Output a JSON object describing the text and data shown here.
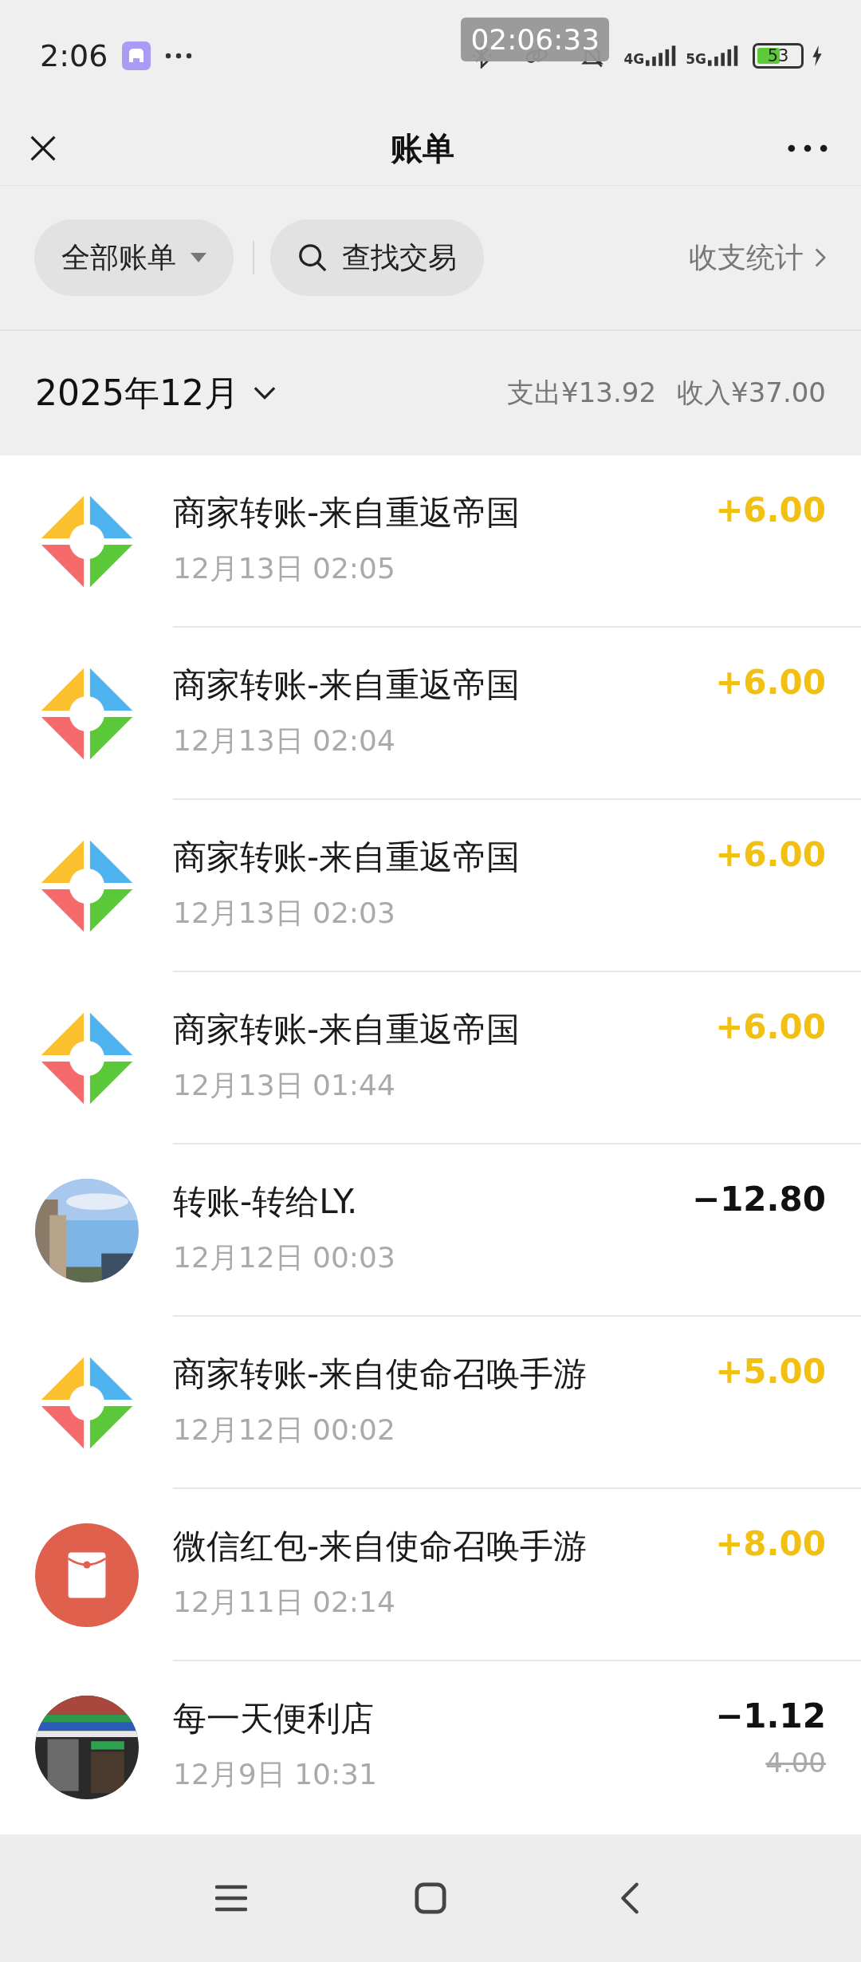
{
  "status_bar": {
    "time": "2:06",
    "recording_timer": "02:06:33",
    "network_1": "4G",
    "network_2": "5G",
    "battery": "53"
  },
  "header": {
    "title": "账单"
  },
  "filters": {
    "category": "全部账单",
    "search": "查找交易",
    "stats": "收支统计"
  },
  "month": {
    "label": "2025年12月",
    "expense": "支出¥13.92",
    "income": "收入¥37.00"
  },
  "transactions": [
    {
      "avatar": {
        "kind": "merchant"
      },
      "title": "商家转账-来自重返帝国",
      "time": "12月13日 02:05",
      "amount": {
        "text": "+6.00",
        "kind": "income"
      }
    },
    {
      "avatar": {
        "kind": "merchant"
      },
      "title": "商家转账-来自重返帝国",
      "time": "12月13日 02:04",
      "amount": {
        "text": "+6.00",
        "kind": "income"
      }
    },
    {
      "avatar": {
        "kind": "merchant"
      },
      "title": "商家转账-来自重返帝国",
      "time": "12月13日 02:03",
      "amount": {
        "text": "+6.00",
        "kind": "income"
      }
    },
    {
      "avatar": {
        "kind": "merchant"
      },
      "title": "商家转账-来自重返帝国",
      "time": "12月13日 01:44",
      "amount": {
        "text": "+6.00",
        "kind": "income"
      }
    },
    {
      "title": "转账-转给LY.",
      "time": "12月12日 00:03",
      "amount": {
        "text": "−12.80",
        "kind": "expense"
      }
    },
    {
      "avatar": {
        "kind": "merchant"
      },
      "title": "商家转账-来自使命召唤手游",
      "time": "12月12日 00:02",
      "amount": {
        "text": "+5.00",
        "kind": "income"
      }
    },
    {
      "avatar": {
        "kind": "envelope"
      },
      "title": "微信红包-来自使命召唤手游",
      "time": "12月11日 02:14",
      "amount": {
        "text": "+8.00",
        "kind": "income"
      }
    },
    {
      "title": "每一天便利店",
      "time": "12月9日 10:31",
      "amount": {
        "text": "−1.12",
        "kind": "expense"
      },
      "original_amount": "4.00"
    }
  ]
}
